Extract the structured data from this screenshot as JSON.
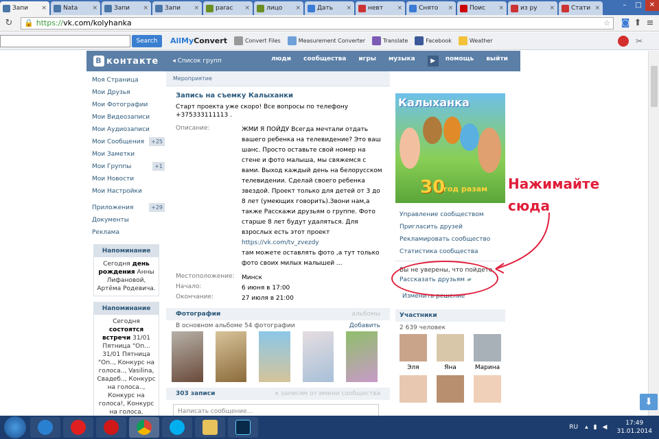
{
  "browser": {
    "tabs": [
      {
        "label": "Запи",
        "color": "#4a76a8",
        "active": true
      },
      {
        "label": "Nata",
        "color": "#4a76a8"
      },
      {
        "label": "Запи",
        "color": "#4a76a8"
      },
      {
        "label": "Запи",
        "color": "#4a76a8"
      },
      {
        "label": "parac",
        "color": "#6b8e23"
      },
      {
        "label": "лицо",
        "color": "#6b8e23"
      },
      {
        "label": "Дать",
        "color": "#3a7bd5"
      },
      {
        "label": "невт",
        "color": "#cc3333"
      },
      {
        "label": "Снято",
        "color": "#3a7bd5"
      },
      {
        "label": "Поис",
        "color": "#cc0000"
      },
      {
        "label": "из ру",
        "color": "#cc3333"
      },
      {
        "label": "Стати",
        "color": "#cc3333"
      }
    ],
    "url_https": "https://",
    "url_rest": "vk.com/kolyhanka"
  },
  "toolbar": {
    "search_label": "Search",
    "allmyconvert_a": "AllMy",
    "allmyconvert_c": "Convert",
    "items": [
      "Convert Files",
      "Measurement Converter",
      "Translate",
      "Facebook",
      "Weather"
    ]
  },
  "vk": {
    "logo_text": "контакте",
    "groups_link": "Список групп",
    "menu": [
      "люди",
      "сообщества",
      "игры",
      "музыка",
      "помощь",
      "выйти"
    ]
  },
  "sidebar": {
    "links": [
      {
        "label": "Моя Страница",
        "count": ""
      },
      {
        "label": "Мои Друзья",
        "count": ""
      },
      {
        "label": "Мои Фотографии",
        "count": ""
      },
      {
        "label": "Мои Видеозаписи",
        "count": ""
      },
      {
        "label": "Мои Аудиозаписи",
        "count": ""
      },
      {
        "label": "Мои Сообщения",
        "count": "+25"
      },
      {
        "label": "Мои Заметки",
        "count": ""
      },
      {
        "label": "Мои Группы",
        "count": "+1"
      },
      {
        "label": "Мои Новости",
        "count": ""
      },
      {
        "label": "Мои Настройки",
        "count": ""
      }
    ],
    "links2": [
      {
        "label": "Приложения",
        "count": "+29"
      },
      {
        "label": "Документы",
        "count": ""
      },
      {
        "label": "Реклама",
        "count": ""
      }
    ],
    "reminder1_title": "Напоминание",
    "reminder1_text_a": "Сегодня ",
    "reminder1_text_b": "день рождения",
    "reminder1_text_c": " Анны Лифановой, Артёма Родевича.",
    "reminder2_title": "Напоминание",
    "reminder2_text_a": "Сегодня ",
    "reminder2_text_b": "состоятся встречи",
    "reminder2_text_c": " 31/01 Пятница \"Оп... 31/01 Пятница \"Оп.., Конкурс на голоса.., Vasilina, Свадеб.., Конкурс на голоса.., Конкурс на голоса!, Конкурс на голоса, Madison Royal Clu.."
  },
  "event": {
    "crumb": "Мероприятие",
    "title": "Запись на съемку Калыханки",
    "status": "Старт проекта уже скоро! Все вопросы по телефону +375333111113 .",
    "desc_label": "Описание:",
    "desc_value": "ЖМИ Я ПОЙДУ Всегда мечтали отдать вашего ребенка на телевидение? Это ваш шанс. Просто оставьте свой номер на стене и фото малыша, мы свяжемся с вами. Выход каждый день на белорусском телевидении. Сделай своего ребенка звездой. Проект только для детей от 3 до 8 лет (умеющих говорить).Звони нам,а также Расскажи друзьям о группе. Фото старше 8 лет будут удаляться. Для взрослых есть этот проект",
    "desc_link": "https://vk.com/tv_zvezdy",
    "desc_tail": "там можете оставлять фото ,а тут только фото своих милых малышей ...",
    "location_label": "Местоположение:",
    "location_value": "Минск",
    "start_label": "Начало:",
    "start_value": "6 июня в 17:00",
    "end_label": "Окончание:",
    "end_value": "27 июля в 21:00",
    "photos_title": "Фотографии",
    "photos_albums": "альбомы",
    "photos_sub": "В основном альбоме 54 фотографии",
    "photos_add": "Добавить",
    "wall_count": "303 записи",
    "wall_filter": "к записям от имени сообщества",
    "wall_placeholder": "Написать сообщение..."
  },
  "sidepanel": {
    "poster_title": "Калыханка",
    "poster_num": "30",
    "poster_sub": "год разам",
    "actions": [
      "Управление сообществом",
      "Пригласить друзей",
      "Рекламировать сообщество",
      "Статистика сообщества"
    ],
    "unsure": "Вы не уверены, что пойдете.",
    "tell_friends": "Рассказать друзьям",
    "change": "Изменить решение",
    "members_title": "Участники",
    "members_count": "2 639 человек",
    "members": [
      "Эля",
      "Яна",
      "Марина"
    ]
  },
  "annotation": {
    "line1": "Нажимайте",
    "line2": "сюда"
  },
  "taskbar": {
    "lang": "RU",
    "time": "17:49",
    "date": "31.01.2014"
  }
}
